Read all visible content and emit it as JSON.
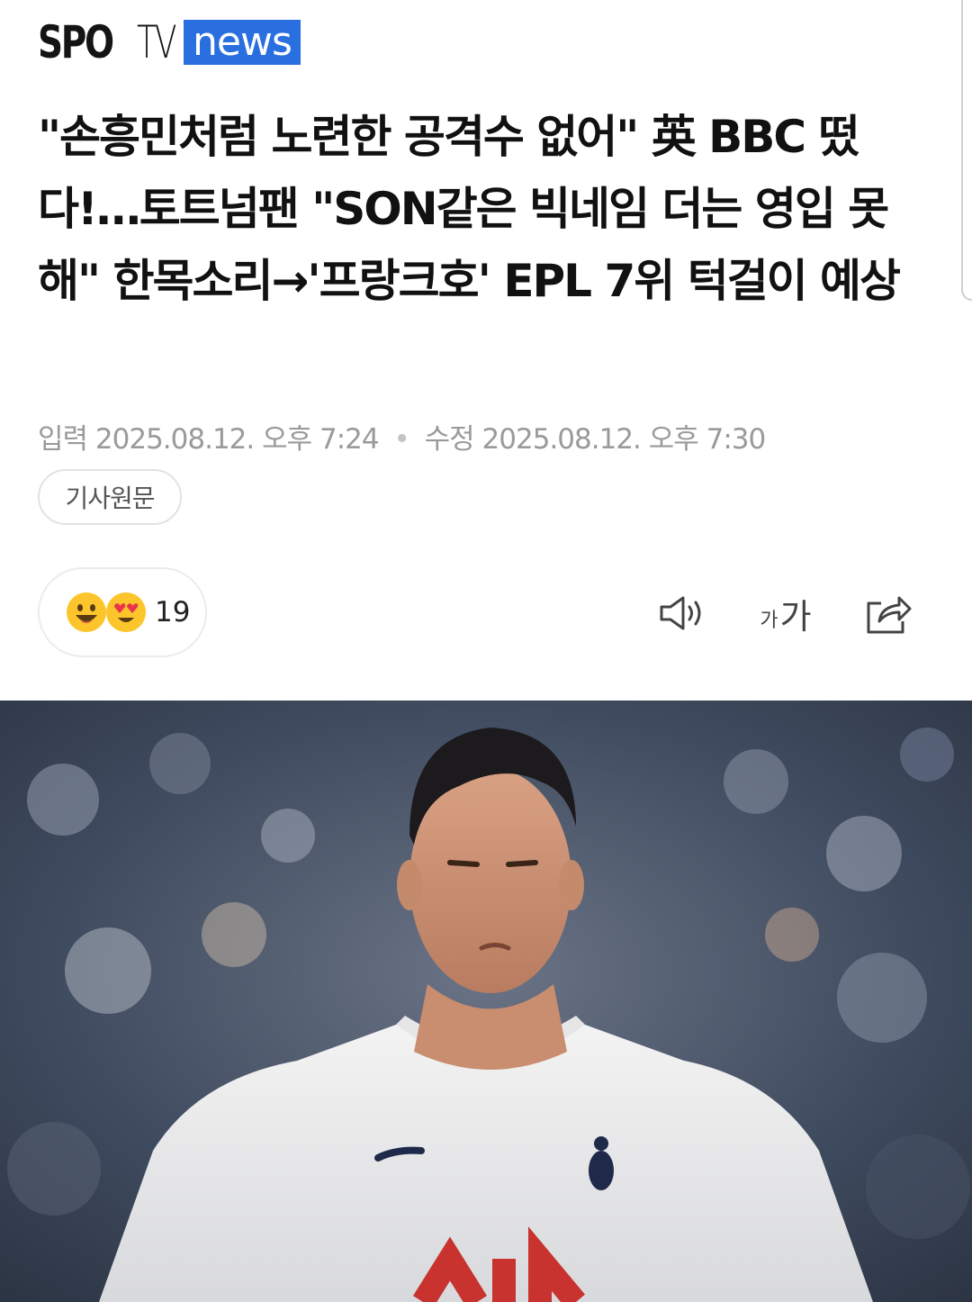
{
  "brand": {
    "logo_spo": "SPO",
    "logo_tv": "TV",
    "logo_news": "news",
    "accent_color": "#2a6fe0"
  },
  "article": {
    "headline": "\"손흥민처럼 노련한 공격수 없어\" 英 BBC 떴다!…토트넘팬 \"SON같은 빅네임 더는 영입 못해\" 한목소리→'프랑크호' EPL 7위 턱걸이 예상",
    "published_label": "입력",
    "published": "2025.08.12. 오후 7:24",
    "modified_label": "수정",
    "modified": "2025.08.12. 오후 7:30",
    "source_button": "기사원문"
  },
  "reactions": {
    "emojis": [
      "smiley-emoji",
      "heart-eyes-emoji"
    ],
    "count": "19"
  },
  "toolbar": {
    "speaker": "speaker-icon",
    "font_small": "가",
    "font_large": "가",
    "share": "share-icon"
  },
  "photo": {
    "subject": "player-photo"
  }
}
